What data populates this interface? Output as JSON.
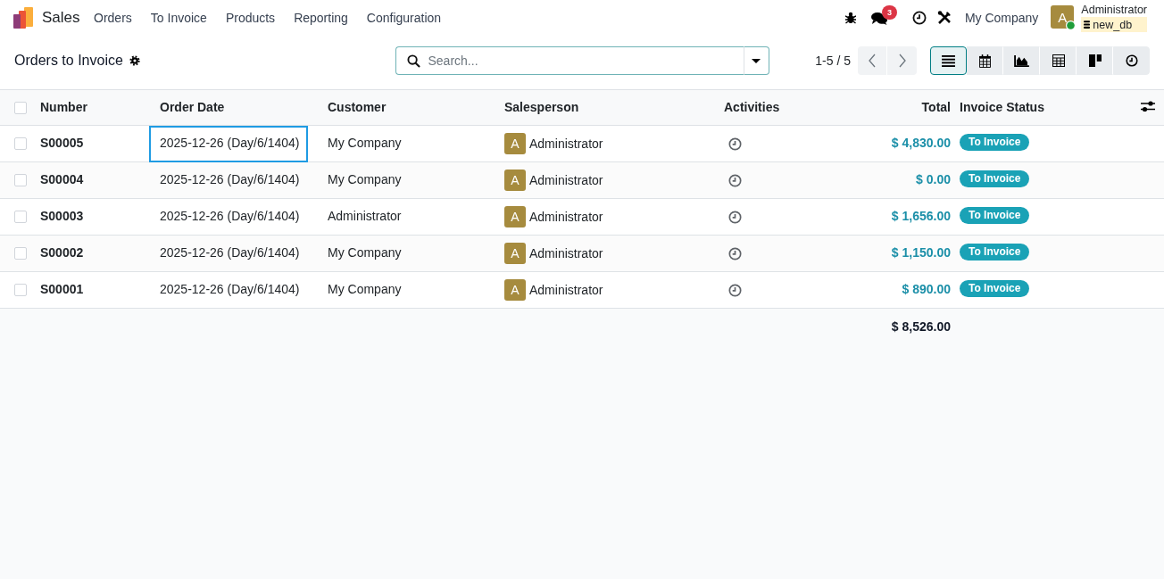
{
  "navbar": {
    "app_name": "Sales",
    "menu": [
      "Orders",
      "To Invoice",
      "Products",
      "Reporting",
      "Configuration"
    ],
    "message_count": "3",
    "company": "My Company",
    "user": {
      "initial": "A",
      "online": true,
      "name": "Administrator",
      "database": "new_db"
    }
  },
  "control_panel": {
    "title": "Orders to Invoice",
    "search": {
      "placeholder": "Search..."
    },
    "pager": "1-5 / 5",
    "views": [
      {
        "kind": "list",
        "selected": true
      },
      {
        "kind": "calendar",
        "selected": false
      },
      {
        "kind": "graph",
        "selected": false
      },
      {
        "kind": "pivot",
        "selected": false
      },
      {
        "kind": "kanban",
        "selected": false
      },
      {
        "kind": "activity",
        "selected": false
      }
    ]
  },
  "table": {
    "all_checked": false,
    "columns": [
      "Number",
      "Order Date",
      "Customer",
      "Salesperson",
      "Activities",
      "Total",
      "Invoice Status"
    ],
    "rows": [
      {
        "checked": false,
        "number": "S00005",
        "order_date": "2025-12-26 (Day/6/1404)",
        "date_focused": true,
        "customer": "My Company",
        "salesperson_initial": "A",
        "salesperson": "Administrator",
        "total": "$ 4,830.00",
        "invoice_status": "To Invoice"
      },
      {
        "checked": false,
        "number": "S00004",
        "order_date": "2025-12-26 (Day/6/1404)",
        "date_focused": false,
        "customer": "My Company",
        "salesperson_initial": "A",
        "salesperson": "Administrator",
        "total": "$ 0.00",
        "invoice_status": "To Invoice"
      },
      {
        "checked": false,
        "number": "S00003",
        "order_date": "2025-12-26 (Day/6/1404)",
        "date_focused": false,
        "customer": "Administrator",
        "salesperson_initial": "A",
        "salesperson": "Administrator",
        "total": "$ 1,656.00",
        "invoice_status": "To Invoice"
      },
      {
        "checked": false,
        "number": "S00002",
        "order_date": "2025-12-26 (Day/6/1404)",
        "date_focused": false,
        "customer": "My Company",
        "salesperson_initial": "A",
        "salesperson": "Administrator",
        "total": "$ 1,150.00",
        "invoice_status": "To Invoice"
      },
      {
        "checked": false,
        "number": "S00001",
        "order_date": "2025-12-26 (Day/6/1404)",
        "date_focused": false,
        "customer": "My Company",
        "salesperson_initial": "A",
        "salesperson": "Administrator",
        "total": "$ 890.00",
        "invoice_status": "To Invoice"
      }
    ],
    "total": "$ 8,526.00"
  }
}
